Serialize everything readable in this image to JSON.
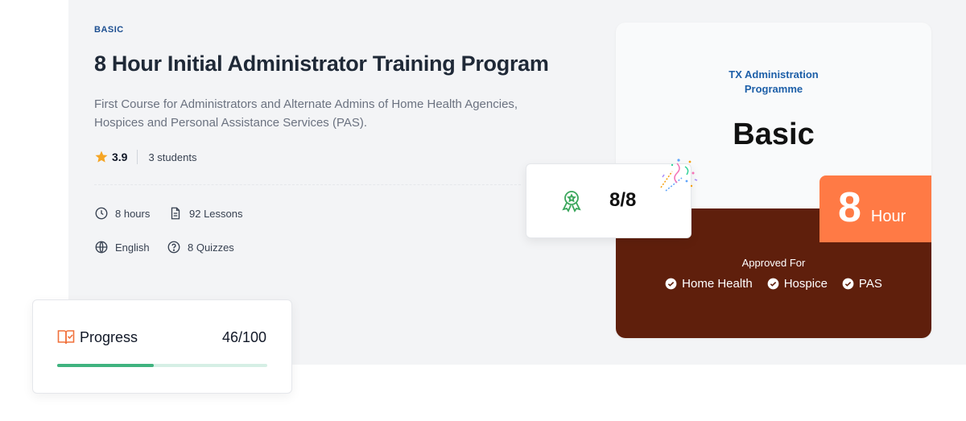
{
  "course": {
    "level": "BASIC",
    "title": "8 Hour Initial Administrator Training Program",
    "description": "First Course for Administrators and Alternate Admins of Home Health Agencies, Hospices and Personal Assistance Services (PAS).",
    "rating": "3.9",
    "students": "3 students",
    "meta": {
      "hours": "8 hours",
      "lessons": "92 Lessons",
      "language": "English",
      "quizzes": "8 Quizzes"
    }
  },
  "card": {
    "subtitle_line1": "TX Administration",
    "subtitle_line2": "Programme",
    "big_label": "Basic",
    "hour_number": "8",
    "hour_unit": "Hour",
    "approved_label": "Approved For",
    "approved_items": [
      "Home Health",
      "Hospice",
      "PAS"
    ]
  },
  "score": {
    "value": "8/8"
  },
  "progress": {
    "label": "Progress",
    "count": "46/100",
    "fraction": 0.46
  },
  "colors": {
    "accent_blue": "#1d5fa8",
    "card_brown": "#5f1f0c",
    "hour_orange": "#ff7a45",
    "progress_green": "#3fb37f",
    "star": "#f5a524"
  },
  "icons": [
    "star-icon",
    "clock-icon",
    "document-icon",
    "globe-icon",
    "question-icon",
    "check-circle-icon",
    "award-icon",
    "confetti-icon",
    "book-progress-icon"
  ]
}
